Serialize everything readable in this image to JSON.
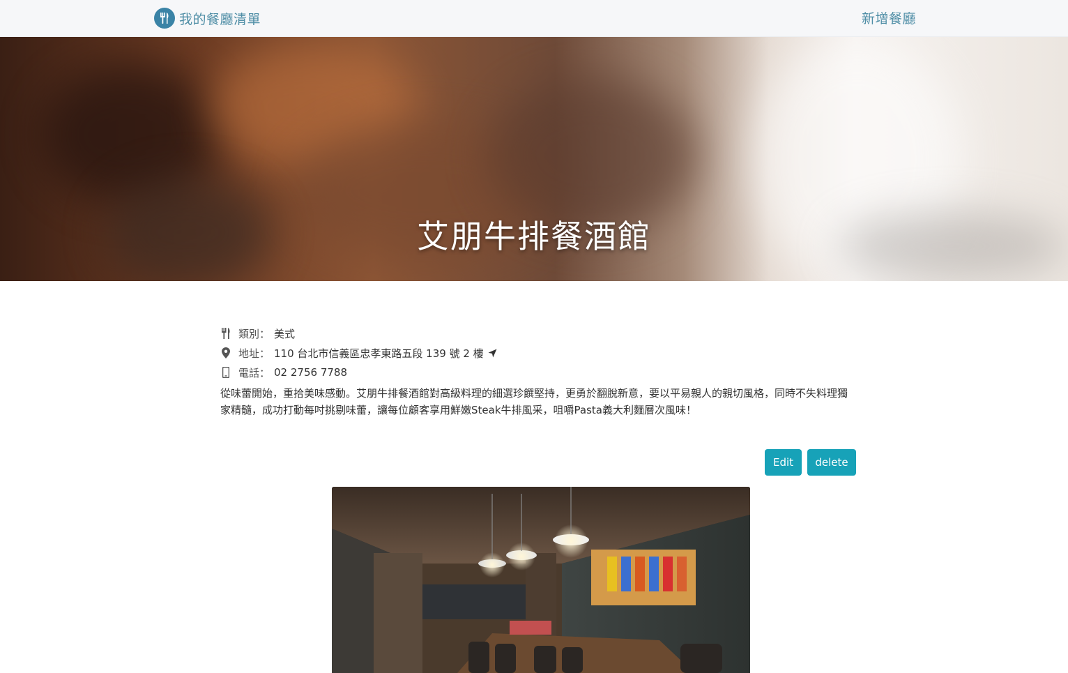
{
  "navbar": {
    "brand_text": "我的餐廳清單",
    "brand_icon": "utensils-icon",
    "new_link": "新增餐廳"
  },
  "restaurant": {
    "name": "艾朋牛排餐酒館",
    "category_label": "類別：",
    "category": "美式",
    "address_label": "地址：",
    "address": "110 台北市信義區忠孝東路五段 139 號 2 樓",
    "phone_label": "電話：",
    "phone": "02 2756 7788",
    "description": "從味蕾開始，重拾美味感動。艾朋牛排餐酒館對高級料理的細選珍饌堅持，更勇於翻脫新意，要以平易親人的親切風格，同時不失料理獨家精髓，成功打動每吋挑剔味蕾，讓每位顧客享用鮮嫩Steak牛排風采，咀嚼Pasta義大利麵層次風味！"
  },
  "actions": {
    "edit_label": "Edit",
    "delete_label": "delete"
  },
  "colors": {
    "accent": "#17a2b8",
    "brand_text": "#4f8ea6",
    "navbar_bg": "#f6f7f9"
  }
}
